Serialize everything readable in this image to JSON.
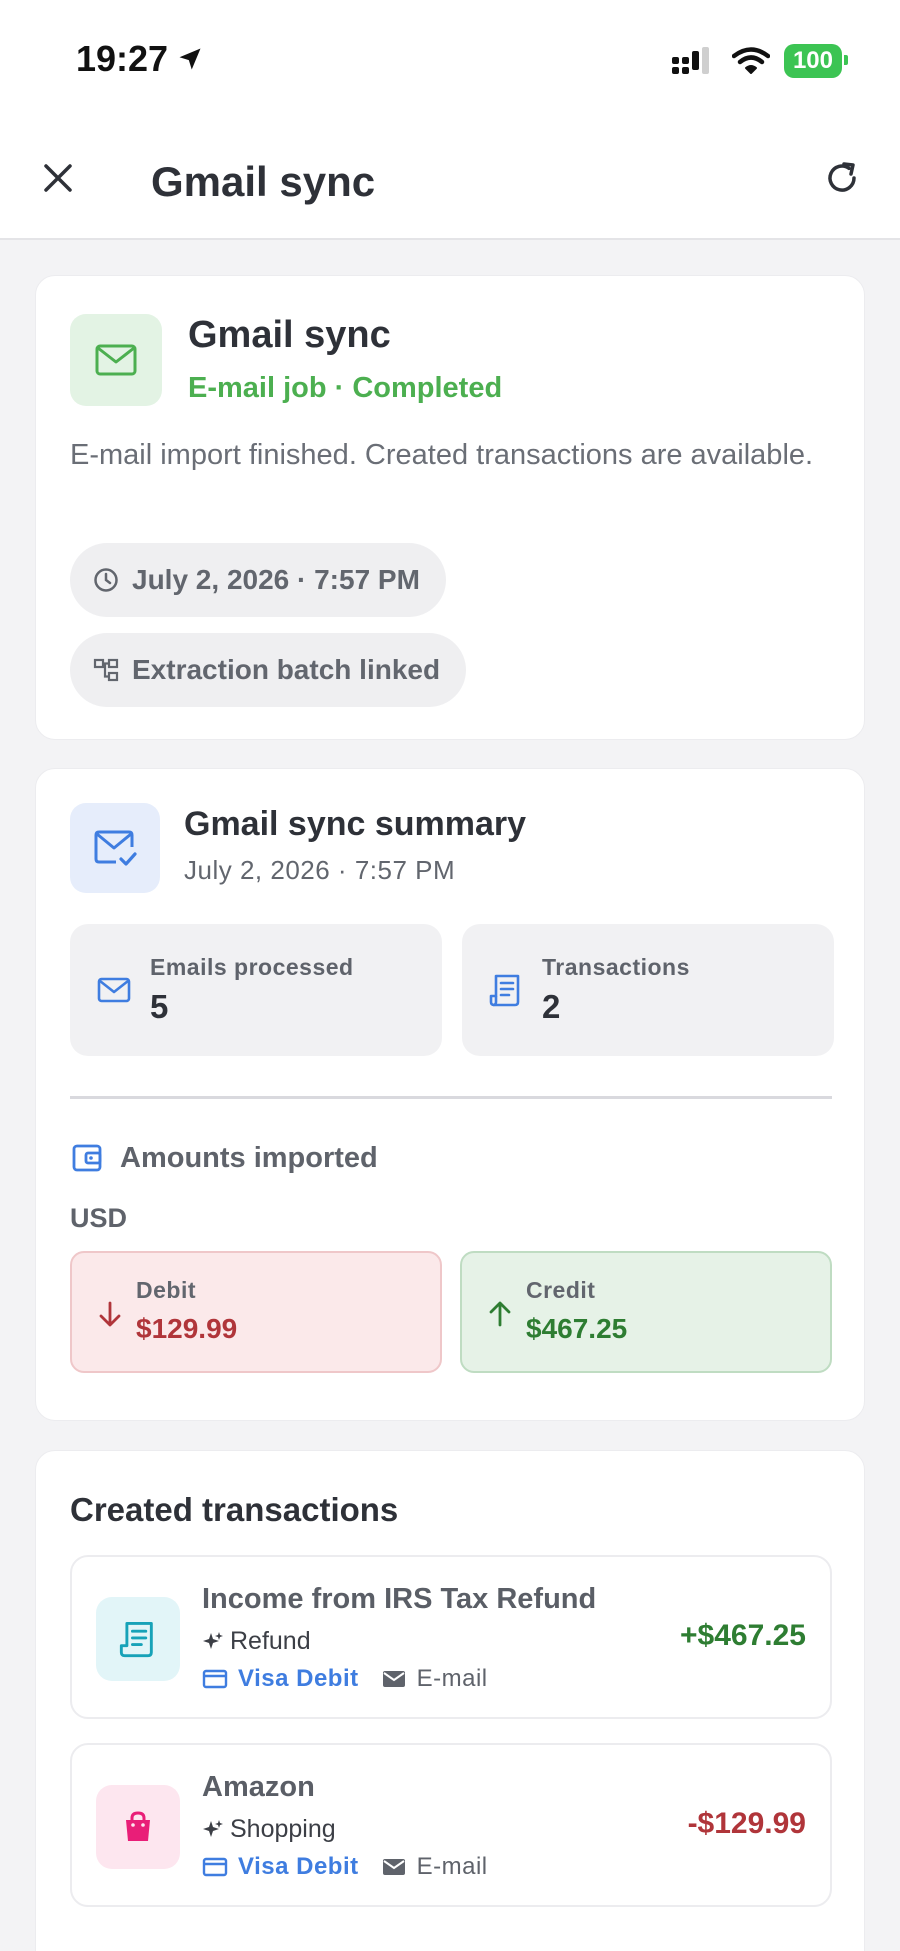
{
  "status_bar": {
    "time": "19:27",
    "battery": "100",
    "icons": [
      "location-arrow-icon",
      "signal-icon",
      "wifi-icon",
      "battery-icon"
    ]
  },
  "nav": {
    "title": "Gmail sync",
    "close_icon": "close-icon",
    "refresh_icon": "refresh-icon"
  },
  "job": {
    "title": "Gmail sync",
    "subtitle": "E-mail job · Completed",
    "description": "E-mail import finished. Created transactions are available.",
    "date_pill": "July 2, 2026 · 7:57 PM",
    "batch_pill": "Extraction batch linked",
    "status_color": "#4caf50"
  },
  "summary": {
    "title": "Gmail sync summary",
    "date": "July 2, 2026 · 7:57 PM",
    "stats": [
      {
        "label": "Emails processed",
        "value": "5",
        "icon": "mail-icon"
      },
      {
        "label": "Transactions",
        "value": "2",
        "icon": "receipt-icon"
      }
    ],
    "amounts_header": "Amounts imported",
    "currency": "USD",
    "debit": {
      "label": "Debit",
      "value": "$129.99"
    },
    "credit": {
      "label": "Credit",
      "value": "$467.25"
    }
  },
  "transactions": {
    "heading": "Created transactions",
    "items": [
      {
        "name": "Income from IRS Tax Refund",
        "category": "Refund",
        "account": "Visa Debit",
        "source": "E-mail",
        "amount": "+$467.25",
        "icon": "receipt-icon",
        "amount_color": "#2e7d32"
      },
      {
        "name": "Amazon",
        "category": "Shopping",
        "account": "Visa Debit",
        "source": "E-mail",
        "amount": "-$129.99",
        "icon": "shopping-bag-icon",
        "amount_color": "#b0353a"
      }
    ]
  },
  "colors": {
    "accent_blue": "#3f7de0",
    "success_green": "#4caf50",
    "debit_red": "#b0353a",
    "credit_green": "#2e7d32"
  }
}
